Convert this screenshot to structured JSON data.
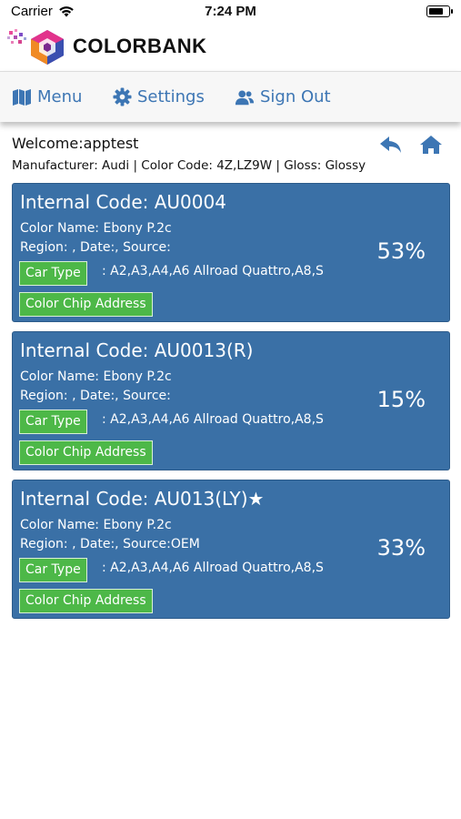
{
  "status": {
    "carrier": "Carrier",
    "time": "7:24 PM"
  },
  "brand": {
    "name": "COLORBANK"
  },
  "nav": {
    "menu": "Menu",
    "settings": "Settings",
    "sign_out": "Sign Out",
    "accent": "#3d76b4"
  },
  "welcome": "Welcome:apptest",
  "filter": "Manufacturer: Audi | Color Code: 4Z,LZ9W | Gloss: Glossy",
  "cards": [
    {
      "code": "Internal Code: AU0004",
      "color_name": "Color Name: Ebony P.2c",
      "meta": "Region: , Date:, Source:",
      "car_type_label": "Car Type",
      "models": ": A2,A3,A4,A6 Allroad Quattro,A8,S",
      "chip_label": "Color Chip Address",
      "percent": "53%"
    },
    {
      "code": "Internal Code: AU0013(R)",
      "color_name": "Color Name: Ebony P.2c",
      "meta": "Region: , Date:, Source:",
      "car_type_label": "Car Type",
      "models": ": A2,A3,A4,A6 Allroad Quattro,A8,S",
      "chip_label": "Color Chip Address",
      "percent": "15%"
    },
    {
      "code": "Internal Code: AU013(LY)★",
      "color_name": "Color Name: Ebony P.2c",
      "meta": "Region: , Date:, Source:OEM",
      "car_type_label": "Car Type",
      "models": ": A2,A3,A4,A6 Allroad Quattro,A8,S",
      "chip_label": "Color Chip Address",
      "percent": "33%"
    }
  ],
  "colors": {
    "card_bg": "#3a70a6",
    "button_green": "#4db848"
  }
}
